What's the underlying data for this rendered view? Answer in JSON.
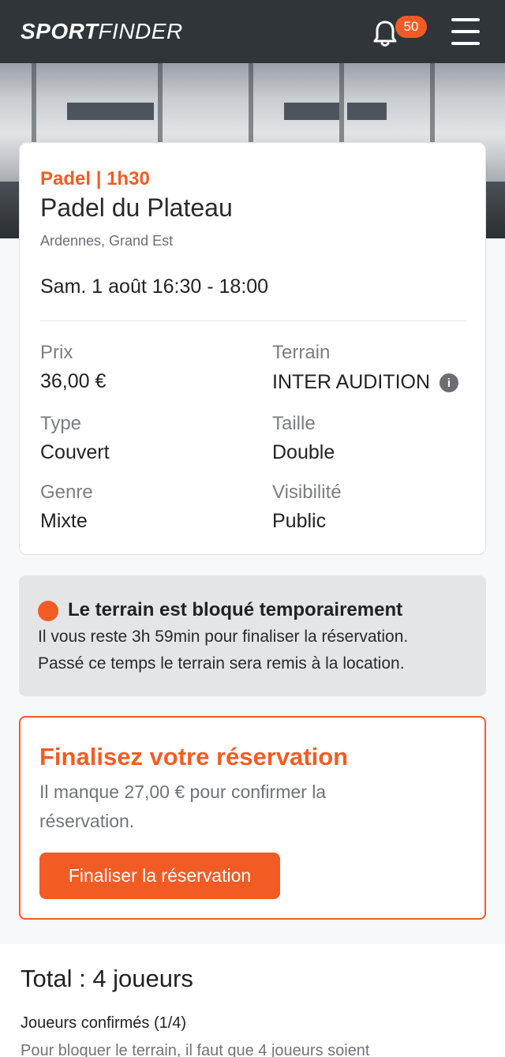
{
  "header": {
    "logo_bold": "SPORT",
    "logo_light": "FINDER",
    "notification_count": "50"
  },
  "icons": {
    "bell": "bell-icon",
    "menu": "menu-icon",
    "share": "share-icon",
    "more": "more-vertical-icon",
    "info": "info-icon"
  },
  "booking": {
    "sport_duration": "Padel | 1h30",
    "venue": "Padel du Plateau",
    "region": "Ardennes, Grand Est",
    "datetime": "Sam. 1 août 16:30 - 18:00",
    "details": {
      "price_label": "Prix",
      "price_value": "36,00 €",
      "court_label": "Terrain",
      "court_value": "INTER AUDITION",
      "type_label": "Type",
      "type_value": "Couvert",
      "size_label": "Taille",
      "size_value": "Double",
      "gender_label": "Genre",
      "gender_value": "Mixte",
      "visibility_label": "Visibilité",
      "visibility_value": "Public"
    }
  },
  "alert": {
    "title": "Le terrain est bloqué temporairement",
    "line1": "Il vous reste 3h 59min pour finaliser la réservation.",
    "line2": "Passé ce temps le terrain sera remis à la location."
  },
  "finalize": {
    "title": "Finalisez votre réservation",
    "text": "Il manque 27,00 € pour confirmer la réservation.",
    "button": "Finaliser la réservation"
  },
  "players": {
    "total": "Total : 4 joueurs",
    "confirmed": "Joueurs confirmés (1/4)",
    "hint": "Pour bloquer le terrain, il faut que 4 joueurs soient"
  },
  "colors": {
    "accent": "#f25c24",
    "topbar": "#30353a"
  }
}
